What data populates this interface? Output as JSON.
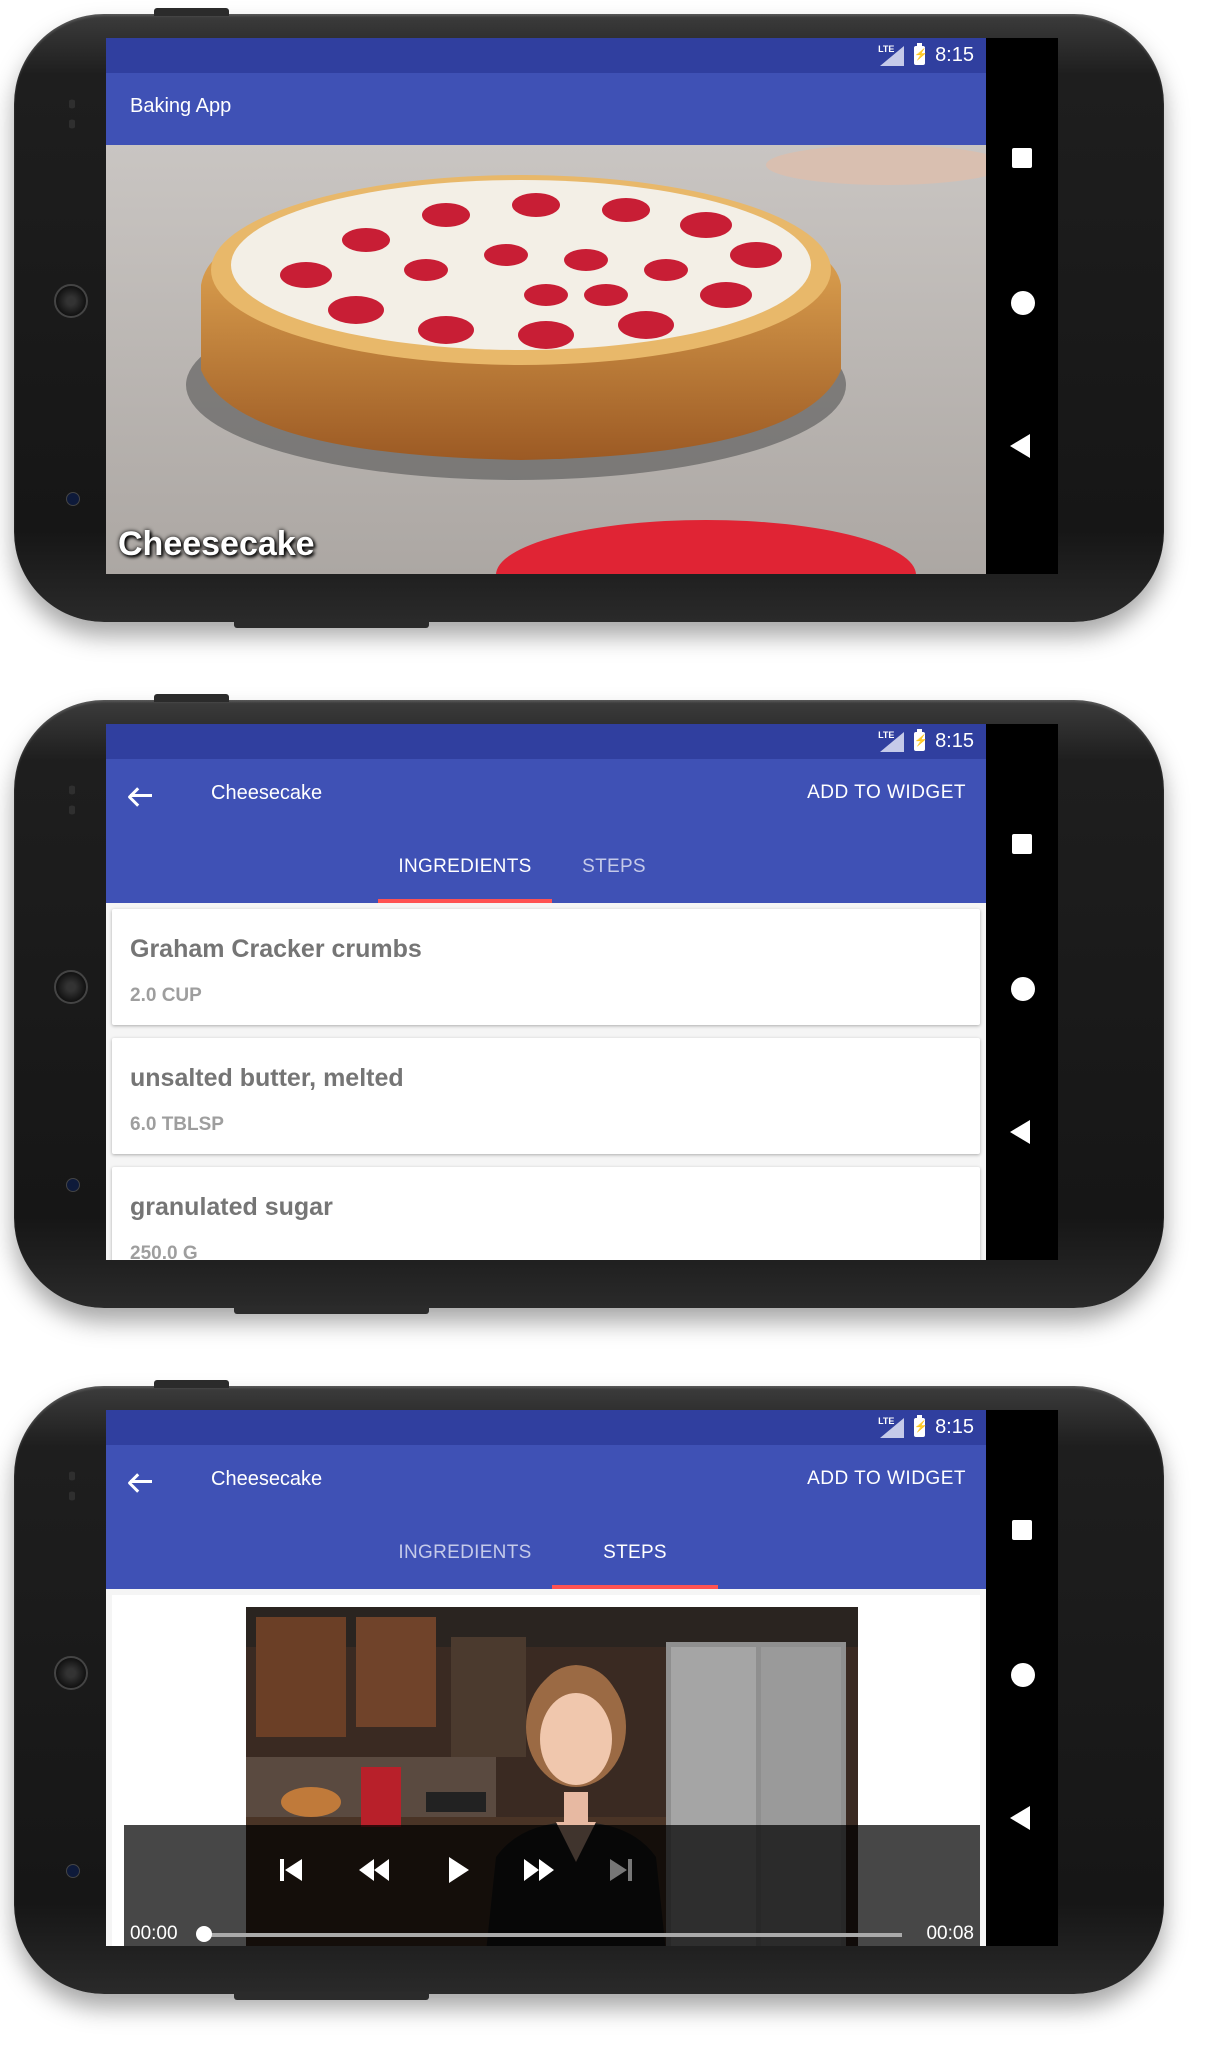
{
  "status": {
    "time": "8:15",
    "network": "LTE"
  },
  "screen1": {
    "app_title": "Baking App",
    "recipe_card_title": "Cheesecake"
  },
  "screen2": {
    "title": "Cheesecake",
    "action": "ADD TO WIDGET",
    "tabs": [
      {
        "label": "INGREDIENTS",
        "active": true
      },
      {
        "label": "STEPS",
        "active": false
      }
    ],
    "ingredients": [
      {
        "name": "Graham Cracker crumbs",
        "qty": "2.0 CUP"
      },
      {
        "name": "unsalted butter, melted",
        "qty": "6.0 TBLSP"
      },
      {
        "name": "granulated sugar",
        "qty": "250.0 G"
      }
    ]
  },
  "screen3": {
    "title": "Cheesecake",
    "action": "ADD TO WIDGET",
    "tabs": [
      {
        "label": "INGREDIENTS",
        "active": false
      },
      {
        "label": "STEPS",
        "active": true
      }
    ],
    "player": {
      "position": "00:00",
      "duration": "00:08",
      "progress": 0.0
    }
  },
  "colors": {
    "primary": "#3f51b5",
    "primary_dark": "#303f9f",
    "accent": "#ff5252"
  },
  "icons": [
    "back-arrow-icon",
    "lte-signal-icon",
    "battery-charging-icon",
    "nav-recents-icon",
    "nav-home-icon",
    "nav-back-icon",
    "skip-previous-icon",
    "rewind-icon",
    "play-icon",
    "fast-forward-icon",
    "skip-next-icon"
  ]
}
